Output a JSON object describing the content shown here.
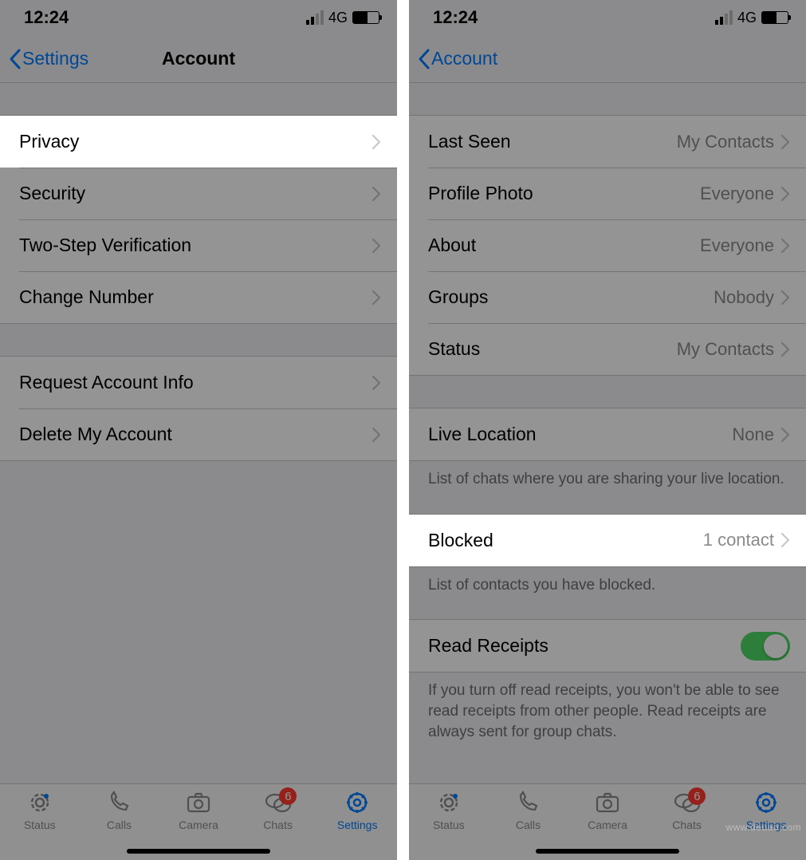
{
  "statusbar": {
    "time": "12:24",
    "network": "4G"
  },
  "left": {
    "back": "Settings",
    "title": "Account",
    "section1": [
      {
        "label": "Privacy"
      },
      {
        "label": "Security"
      },
      {
        "label": "Two-Step Verification"
      },
      {
        "label": "Change Number"
      }
    ],
    "section2": [
      {
        "label": "Request Account Info"
      },
      {
        "label": "Delete My Account"
      }
    ]
  },
  "right": {
    "back": "Account",
    "rows": {
      "last_seen": {
        "label": "Last Seen",
        "value": "My Contacts"
      },
      "profile_photo": {
        "label": "Profile Photo",
        "value": "Everyone"
      },
      "about": {
        "label": "About",
        "value": "Everyone"
      },
      "groups": {
        "label": "Groups",
        "value": "Nobody"
      },
      "status": {
        "label": "Status",
        "value": "My Contacts"
      },
      "live_location": {
        "label": "Live Location",
        "value": "None"
      },
      "live_location_footer": "List of chats where you are sharing your live location.",
      "blocked": {
        "label": "Blocked",
        "value": "1 contact"
      },
      "blocked_footer": "List of contacts you have blocked.",
      "read_receipts": {
        "label": "Read Receipts"
      },
      "read_receipts_footer": "If you turn off read receipts, you won't be able to see read receipts from other people. Read receipts are always sent for group chats."
    }
  },
  "tabs": {
    "status": "Status",
    "calls": "Calls",
    "camera": "Camera",
    "chats": "Chats",
    "settings": "Settings",
    "chats_badge": "6"
  },
  "watermark": "www.deuao.com"
}
